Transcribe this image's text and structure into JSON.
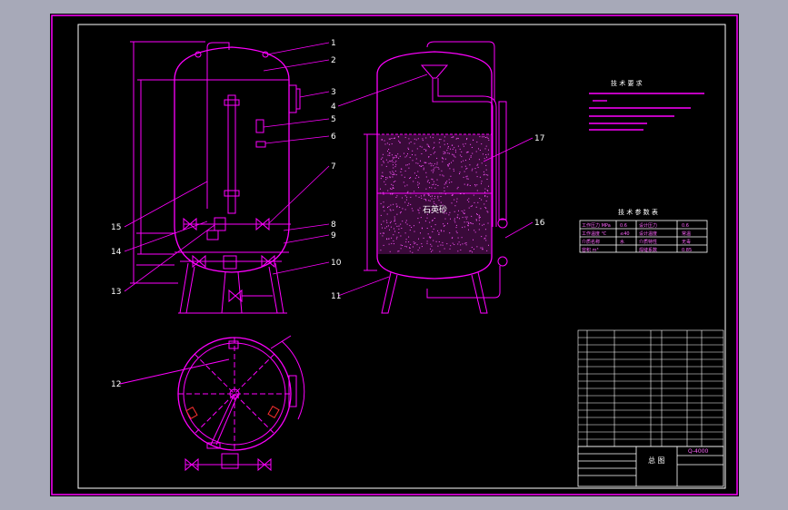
{
  "colors": {
    "outer_bg": "#a7a9b8",
    "sheet_bg": "#000000",
    "line": "#ff00ff",
    "frame": "#ffffff"
  },
  "callouts": [
    "1",
    "2",
    "3",
    "4",
    "5",
    "6",
    "7",
    "8",
    "9",
    "10",
    "11",
    "12",
    "13",
    "14",
    "15",
    "16",
    "17"
  ],
  "center_label": "石英砂",
  "tech_title": "技 术 要 求",
  "design_title": "技 术 参 数 表",
  "params": [
    [
      "工作压力 MPa",
      "0.6",
      "设计压力",
      "0.6"
    ],
    [
      "工作温度 ℃",
      "≤40",
      "设计温度",
      "常温"
    ],
    [
      "介质名称",
      "水",
      "介质特性",
      "无毒"
    ],
    [
      "容积 m³",
      "",
      "焊缝系数",
      "0.85"
    ]
  ],
  "title_block": {
    "name": "总 图",
    "code": "Q-4000"
  }
}
